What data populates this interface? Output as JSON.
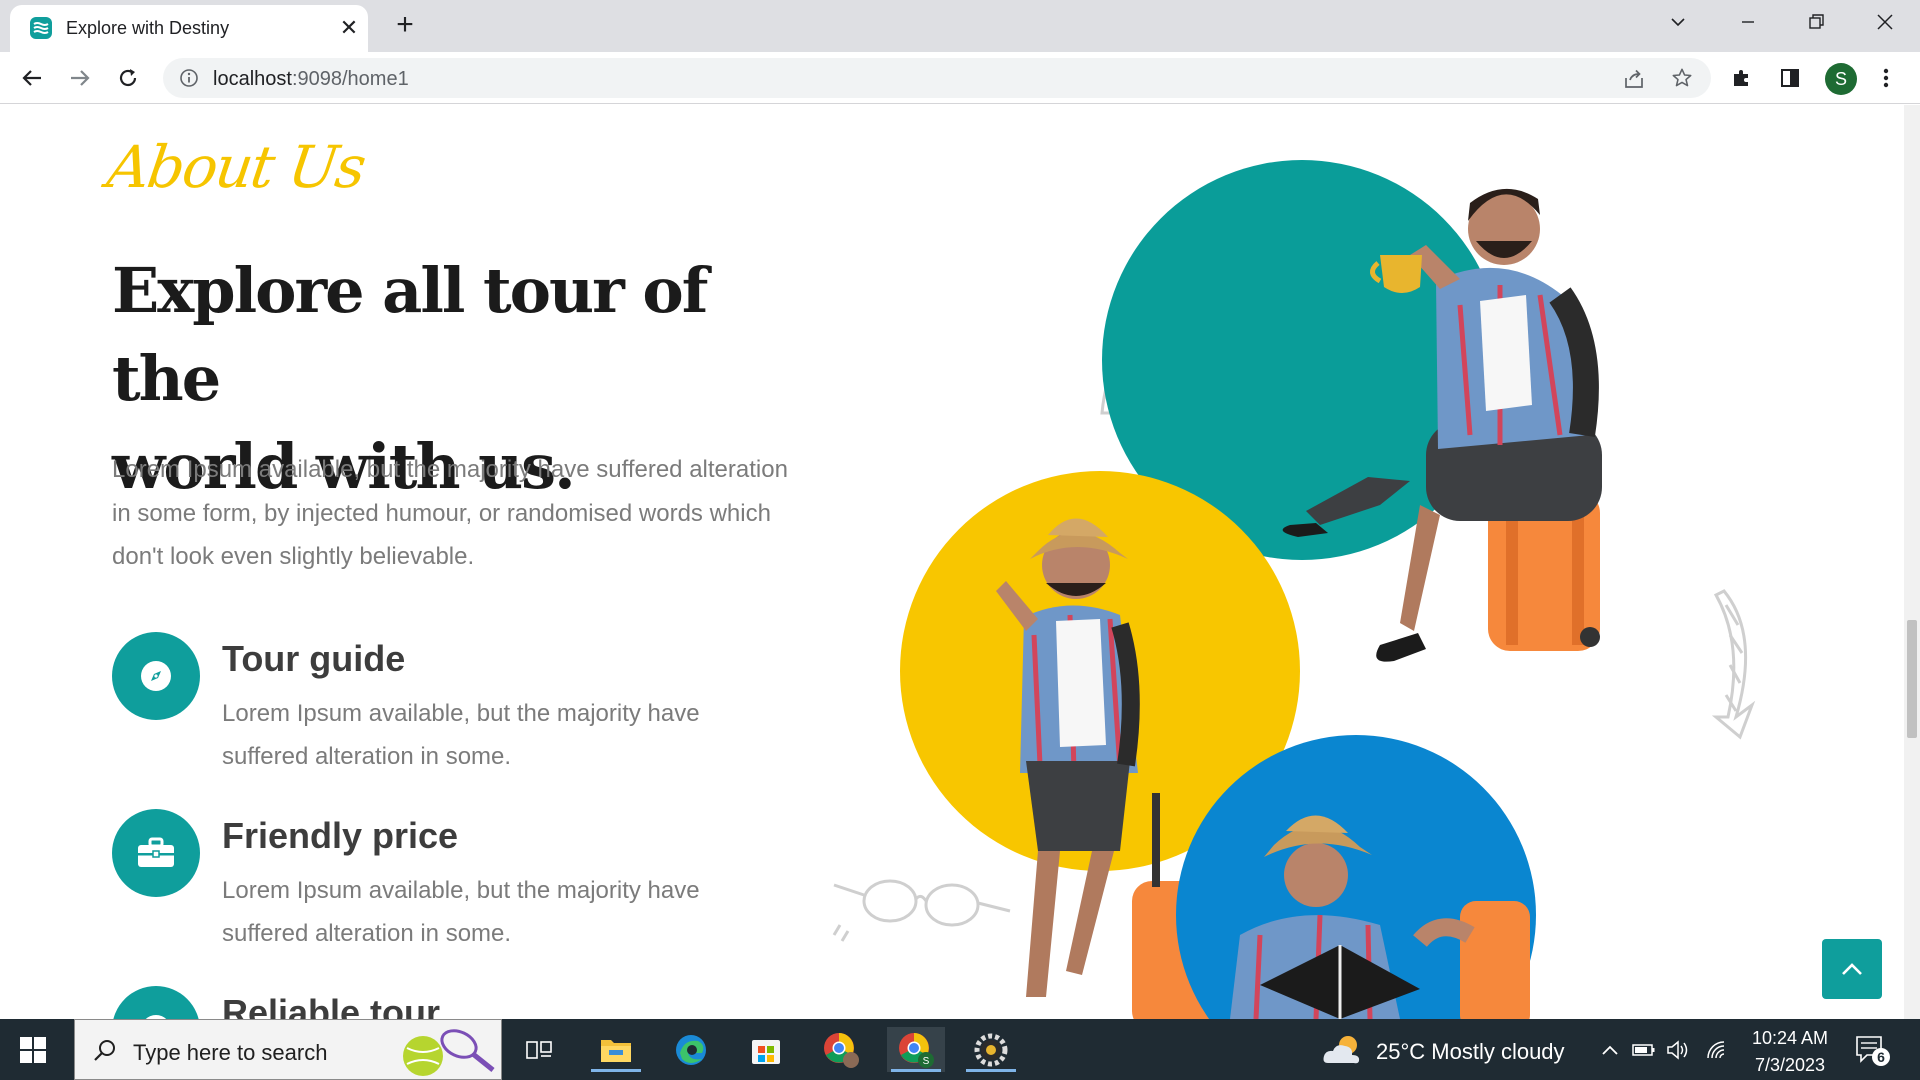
{
  "browser": {
    "tab_title": "Explore with Destiny",
    "url_host": "localhost",
    "url_path": ":9098/home1",
    "profile_initial": "S"
  },
  "page": {
    "about_label": "About Us",
    "headline_line1": "Explore all tour of the",
    "headline_line2": "world with us.",
    "intro": "Lorem Ipsum available, but the majority have suffered alteration in some form, by injected humour, or randomised words which don't look even slightly believable.",
    "features": [
      {
        "title": "Tour guide",
        "desc": "Lorem Ipsum available, but the majority have suffered alteration in some.",
        "icon": "compass-icon"
      },
      {
        "title": "Friendly price",
        "desc": "Lorem Ipsum available, but the majority have suffered alteration in some.",
        "icon": "briefcase-icon"
      },
      {
        "title": "Reliable tour",
        "desc": "",
        "icon": "globe-icon"
      }
    ],
    "colors": {
      "accent": "#0f9e9c",
      "yellow": "#f6c500",
      "blue": "#0a86d0",
      "orange": "#f6883c"
    }
  },
  "taskbar": {
    "search_placeholder": "Type here to search",
    "weather": "25°C  Mostly cloudy",
    "time": "10:24 AM",
    "date": "7/3/2023",
    "notification_count": "6"
  }
}
